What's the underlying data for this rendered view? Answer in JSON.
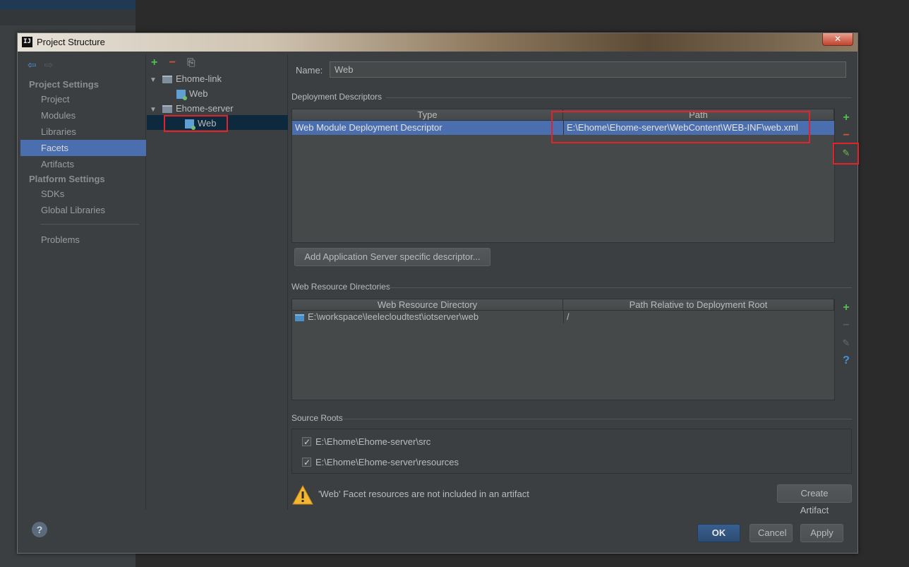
{
  "window": {
    "title": "Project Structure",
    "app_icon_text": "IJ",
    "close_label": "✕"
  },
  "sidebar": {
    "nav_back": "⇦",
    "nav_forward": "⇨",
    "project_settings_header": "Project Settings",
    "platform_settings_header": "Platform Settings",
    "items": [
      {
        "label": "Project"
      },
      {
        "label": "Modules"
      },
      {
        "label": "Libraries"
      },
      {
        "label": "Facets",
        "selected": true
      },
      {
        "label": "Artifacts"
      },
      {
        "label": "SDKs"
      },
      {
        "label": "Global Libraries"
      },
      {
        "label": "Problems"
      }
    ]
  },
  "facet_tree": {
    "toolbar": {
      "add": "+",
      "remove": "−",
      "copy": "⎘"
    },
    "nodes": [
      {
        "label": "Ehome-link",
        "type": "folder",
        "expanded": true
      },
      {
        "label": "Web",
        "type": "facet"
      },
      {
        "label": "Ehome-server",
        "type": "folder",
        "expanded": true
      },
      {
        "label": "Web",
        "type": "facet",
        "selected": true
      }
    ],
    "expand_arrow": "▼"
  },
  "facet": {
    "name_label": "Name:",
    "name_value": "Web",
    "deployment": {
      "title": "Deployment Descriptors",
      "columns": [
        "Type",
        "Path"
      ],
      "rows": [
        {
          "type": "Web Module Deployment Descriptor",
          "path": "E:\\Ehome\\Ehome-server\\WebContent\\WEB-INF\\web.xml",
          "selected": true
        }
      ],
      "add_server_button": "Add Application Server specific descriptor..."
    },
    "resources": {
      "title": "Web Resource Directories",
      "columns": [
        "Web Resource Directory",
        "Path Relative to Deployment Root"
      ],
      "rows": [
        {
          "directory": "E:\\workspace\\leelecloudtest\\iotserver\\web",
          "relative": "/"
        }
      ]
    },
    "source_roots": {
      "title": "Source Roots",
      "items": [
        {
          "path": "E:\\Ehome\\Ehome-server\\src",
          "checked": true
        },
        {
          "path": "E:\\Ehome\\Ehome-server\\resources",
          "checked": true
        }
      ]
    },
    "warning": {
      "text": "'Web' Facet resources are not included in an artifact",
      "action_button": "Create Artifact"
    },
    "side_tools": {
      "add": "+",
      "remove": "−",
      "edit": "✎",
      "help": "?"
    }
  },
  "footer": {
    "help": "?",
    "ok": "OK",
    "cancel": "Cancel",
    "apply": "Apply"
  },
  "colors": {
    "selection": "#4b6eaf",
    "tree_selection": "#0d293e",
    "highlight_box": "#e2232a",
    "add_green": "#4fc14f",
    "remove_red": "#d4533b"
  }
}
